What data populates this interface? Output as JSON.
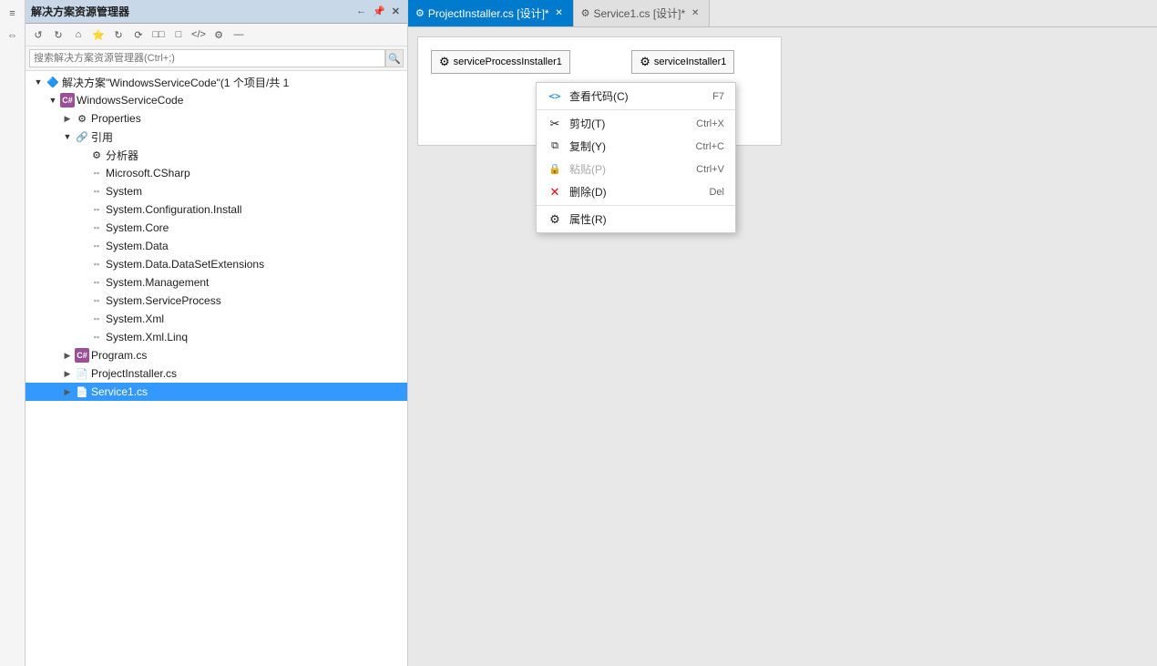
{
  "verticalToolbar": {
    "icons": [
      "≡",
      "⇔"
    ]
  },
  "solutionExplorer": {
    "title": "解决方案资源管理器",
    "headerIcons": [
      "←",
      "→",
      "📌",
      "✕"
    ],
    "toolbarButtons": [
      "↺",
      "↻",
      "⌂",
      "⭐",
      "↻",
      "⟳",
      "□□",
      "□",
      "</>",
      "⚙",
      "—"
    ],
    "searchPlaceholder": "搜索解决方案资源管理器(Ctrl+;)",
    "tree": [
      {
        "id": "solution",
        "level": 0,
        "arrow": true,
        "expanded": true,
        "icon": "🔷",
        "label": "解决方案\"WindowsServiceCode\"(1 个项目/共 1"
      },
      {
        "id": "project",
        "level": 1,
        "arrow": true,
        "expanded": true,
        "icon": "C#",
        "label": "WindowsServiceCode"
      },
      {
        "id": "properties",
        "level": 2,
        "arrow": true,
        "expanded": false,
        "icon": "⚙",
        "label": "Properties"
      },
      {
        "id": "references",
        "level": 2,
        "arrow": true,
        "expanded": true,
        "icon": "ref",
        "label": "引用"
      },
      {
        "id": "analyzers",
        "level": 3,
        "arrow": false,
        "icon": "⚙",
        "label": "分析器"
      },
      {
        "id": "microsoft-csharp",
        "level": 3,
        "arrow": false,
        "icon": "ref",
        "label": "Microsoft.CSharp"
      },
      {
        "id": "system",
        "level": 3,
        "arrow": false,
        "icon": "ref",
        "label": "System"
      },
      {
        "id": "system-config",
        "level": 3,
        "arrow": false,
        "icon": "ref",
        "label": "System.Configuration.Install"
      },
      {
        "id": "system-core",
        "level": 3,
        "arrow": false,
        "icon": "ref",
        "label": "System.Core"
      },
      {
        "id": "system-data",
        "level": 3,
        "arrow": false,
        "icon": "ref",
        "label": "System.Data"
      },
      {
        "id": "system-data-dse",
        "level": 3,
        "arrow": false,
        "icon": "ref",
        "label": "System.Data.DataSetExtensions"
      },
      {
        "id": "system-mgmt",
        "level": 3,
        "arrow": false,
        "icon": "ref",
        "label": "System.Management"
      },
      {
        "id": "system-svcproc",
        "level": 3,
        "arrow": false,
        "icon": "ref",
        "label": "System.ServiceProcess"
      },
      {
        "id": "system-xml",
        "level": 3,
        "arrow": false,
        "icon": "ref",
        "label": "System.Xml"
      },
      {
        "id": "system-xmllinq",
        "level": 3,
        "arrow": false,
        "icon": "ref",
        "label": "System.Xml.Linq"
      },
      {
        "id": "program",
        "level": 2,
        "arrow": true,
        "expanded": false,
        "icon": "C#",
        "label": "Program.cs"
      },
      {
        "id": "projectinstaller",
        "level": 2,
        "arrow": true,
        "expanded": false,
        "icon": "📄",
        "label": "ProjectInstaller.cs"
      },
      {
        "id": "service1",
        "level": 2,
        "arrow": true,
        "expanded": false,
        "icon": "📄",
        "label": "Service1.cs",
        "selected": true
      }
    ]
  },
  "tabs": [
    {
      "id": "projectinstaller-tab",
      "label": "ProjectInstaller.cs [设计]*",
      "active": true,
      "icon": "⚙"
    },
    {
      "id": "service1-tab",
      "label": "Service1.cs [设计]*",
      "active": false,
      "icon": "⚙"
    }
  ],
  "designer": {
    "components": [
      {
        "id": "serviceProcessInstaller1",
        "label": "serviceProcessInstaller1",
        "icon": "⚙"
      },
      {
        "id": "serviceInstaller1",
        "label": "serviceInstaller1",
        "icon": "⚙"
      }
    ]
  },
  "contextMenu": {
    "items": [
      {
        "id": "view-code",
        "icon": "<>",
        "label": "查看代码(C)",
        "shortcut": "F7",
        "disabled": false
      },
      {
        "id": "separator1",
        "type": "separator"
      },
      {
        "id": "cut",
        "icon": "✂",
        "label": "剪切(T)",
        "shortcut": "Ctrl+X",
        "disabled": false
      },
      {
        "id": "copy",
        "icon": "📋",
        "label": "复制(Y)",
        "shortcut": "Ctrl+C",
        "disabled": false
      },
      {
        "id": "paste",
        "icon": "🔒",
        "label": "粘贴(P)",
        "shortcut": "Ctrl+V",
        "disabled": true
      },
      {
        "id": "delete",
        "icon": "✕",
        "label": "删除(D)",
        "shortcut": "Del",
        "disabled": false,
        "iconColor": "red"
      },
      {
        "id": "separator2",
        "type": "separator"
      },
      {
        "id": "properties",
        "icon": "⚙",
        "label": "属性(R)",
        "shortcut": "",
        "disabled": false
      }
    ]
  }
}
